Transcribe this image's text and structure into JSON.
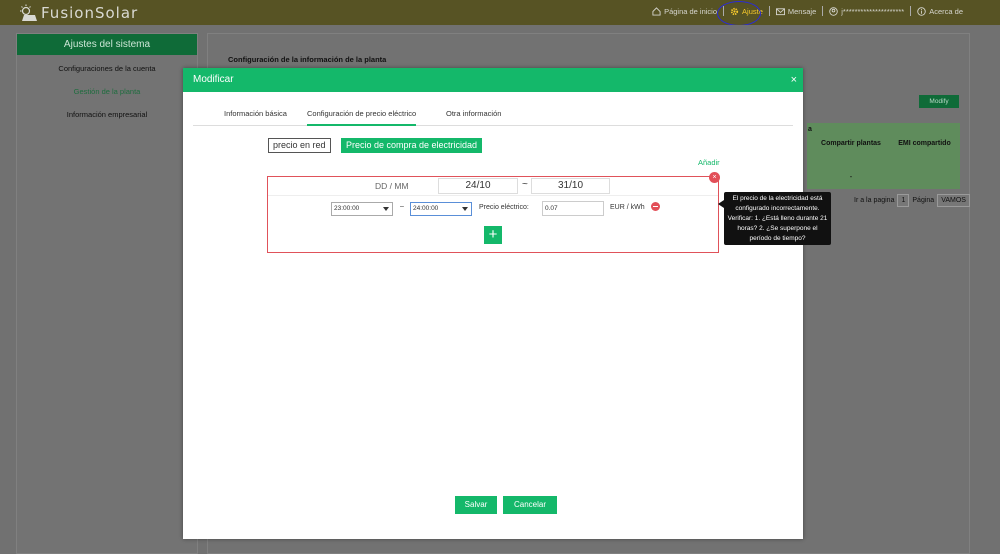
{
  "app": {
    "logo_text": "FusionSolar"
  },
  "topnav": {
    "home": "Página de inicio",
    "settings": "Ajuste",
    "message": "Mensaje",
    "user": "j*********************",
    "about": "Acerca de"
  },
  "sidebar": {
    "title": "Ajustes del sistema",
    "items": [
      {
        "label": "Configuraciones de la cuenta"
      },
      {
        "label": "Gestión de la planta"
      },
      {
        "label": "Información empresarial"
      }
    ]
  },
  "main": {
    "title": "Configuración de la información de la planta",
    "modify_label": "Modify",
    "table": {
      "headers": [
        "a",
        "Compartir plantas",
        "EMI compartido"
      ],
      "row": [
        "-"
      ]
    },
    "pager": {
      "goto_label": "Ir a la pagina",
      "page_value": "1",
      "page_label": "Página",
      "go_label": "VAMOS"
    }
  },
  "modal": {
    "title": "Modificar",
    "close": "×",
    "tabs": [
      {
        "label": "Información básica"
      },
      {
        "label": "Configuración de precio eléctrico"
      },
      {
        "label": "Otra información"
      }
    ],
    "mode_grid": "precio en red",
    "mode_purchase": "Precio de compra de electricidad",
    "add_label": "Añadir",
    "period": {
      "date_label": "DD / MM",
      "start_date": "24/10",
      "tilde": "~",
      "end_date": "31/10",
      "remove": "×",
      "start_time": "23:00:00",
      "dash": "–",
      "end_time": "24:00:00",
      "price_label": "Precio eléctrico:",
      "price_value": "0.07",
      "unit": "EUR / kWh",
      "plus": "+"
    },
    "tooltip": "El precio de la electricidad está configurado incorrectamente. Verificar: 1. ¿Está lleno durante 21 horas? 2. ¿Se superpone el período de tiempo?",
    "save_label": "Salvar",
    "cancel_label": "Cancelar"
  },
  "colors": {
    "primary": "#14b86a",
    "error": "#e24f58",
    "topbar": "#575324"
  }
}
